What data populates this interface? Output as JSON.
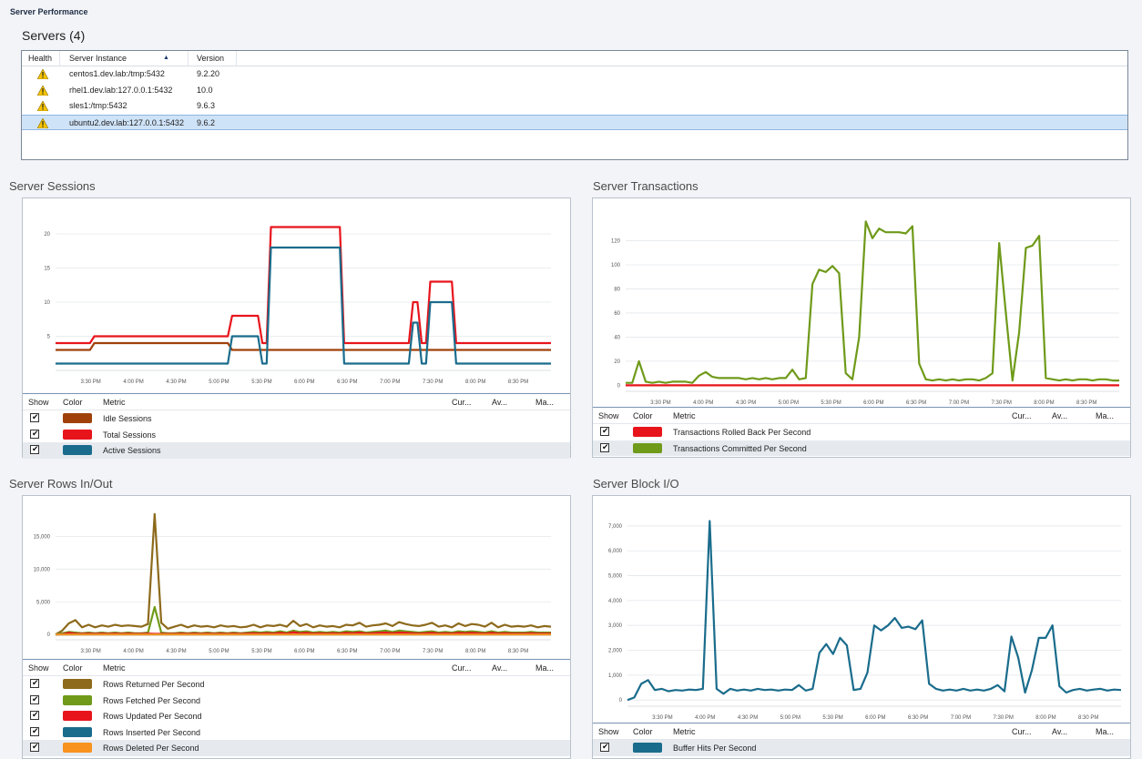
{
  "page": {
    "title": "Server Performance"
  },
  "servers": {
    "title": "Servers (4)",
    "columns": {
      "health": "Health",
      "instance": "Server Instance",
      "sort_indicator": "▲",
      "version": "Version"
    },
    "rows": [
      {
        "instance": "centos1.dev.lab:/tmp:5432",
        "version": "9.2.20",
        "health": "warning-icon"
      },
      {
        "instance": "rhel1.dev.lab:127.0.0.1:5432",
        "version": "10.0",
        "health": "warning-icon"
      },
      {
        "instance": "sles1:/tmp:5432",
        "version": "9.6.3",
        "health": "warning-icon"
      },
      {
        "instance": "ubuntu2.dev.lab:127.0.0.1:5432",
        "version": "9.6.2",
        "health": "warning-icon",
        "selected": true
      }
    ]
  },
  "legend_columns": {
    "show": "Show",
    "color": "Color",
    "metric": "Metric",
    "current": "Cur...",
    "average": "Av...",
    "max": "Ma..."
  },
  "x_tick_labels": [
    "3:30 PM",
    "4:00 PM",
    "4:30 PM",
    "5:00 PM",
    "5:30 PM",
    "6:00 PM",
    "6:30 PM",
    "7:00 PM",
    "7:30 PM",
    "8:00 PM",
    "8:30 PM"
  ],
  "chart_data": [
    {
      "id": "sessions",
      "type": "line",
      "title": "Server Sessions",
      "ylim": [
        0,
        22
      ],
      "yticks": [
        5,
        10,
        15,
        20
      ],
      "ytick_labels": [
        "5",
        "10",
        "15",
        "20"
      ],
      "series": [
        {
          "name": "Idle Sessions",
          "color": "#a0410a",
          "values": [
            3,
            3,
            3,
            3,
            3,
            3,
            3,
            3,
            3,
            4,
            4,
            4,
            4,
            4,
            4,
            4,
            4,
            4,
            4,
            4,
            4,
            4,
            4,
            4,
            4,
            4,
            4,
            4,
            4,
            4,
            4,
            4,
            4,
            4,
            4,
            4,
            4,
            4,
            4,
            4,
            4,
            3,
            3,
            3,
            3,
            3,
            3,
            3,
            3,
            3,
            3,
            3,
            3,
            3,
            3,
            3,
            3,
            3,
            3,
            3,
            3,
            3,
            3,
            3,
            3,
            3,
            3,
            3,
            3,
            3,
            3,
            3,
            3,
            3,
            3,
            3,
            3,
            3,
            3,
            3,
            3,
            3,
            3,
            3,
            3,
            3,
            3,
            3,
            3,
            3,
            3,
            3,
            3,
            3,
            3,
            3,
            3,
            3,
            3,
            3,
            3,
            3,
            3,
            3,
            3,
            3,
            3,
            3,
            3,
            3,
            3,
            3,
            3,
            3,
            3,
            3
          ]
        },
        {
          "name": "Total Sessions",
          "color": "#e8141c",
          "values": [
            4,
            4,
            4,
            4,
            4,
            4,
            4,
            4,
            4,
            5,
            5,
            5,
            5,
            5,
            5,
            5,
            5,
            5,
            5,
            5,
            5,
            5,
            5,
            5,
            5,
            5,
            5,
            5,
            5,
            5,
            5,
            5,
            5,
            5,
            5,
            5,
            5,
            5,
            5,
            5,
            5,
            8,
            8,
            8,
            8,
            8,
            8,
            8,
            4,
            4,
            21,
            21,
            21,
            21,
            21,
            21,
            21,
            21,
            21,
            21,
            21,
            21,
            21,
            21,
            21,
            21,
            21,
            4,
            4,
            4,
            4,
            4,
            4,
            4,
            4,
            4,
            4,
            4,
            4,
            4,
            4,
            4,
            4,
            10,
            10,
            4,
            4,
            13,
            13,
            13,
            13,
            13,
            13,
            4,
            4,
            4,
            4,
            4,
            4,
            4,
            4,
            4,
            4,
            4,
            4,
            4,
            4,
            4,
            4,
            4,
            4,
            4,
            4,
            4,
            4,
            4
          ]
        },
        {
          "name": "Active Sessions",
          "color": "#1a6c8c",
          "values": [
            1,
            1,
            1,
            1,
            1,
            1,
            1,
            1,
            1,
            1,
            1,
            1,
            1,
            1,
            1,
            1,
            1,
            1,
            1,
            1,
            1,
            1,
            1,
            1,
            1,
            1,
            1,
            1,
            1,
            1,
            1,
            1,
            1,
            1,
            1,
            1,
            1,
            1,
            1,
            1,
            1,
            5,
            5,
            5,
            5,
            5,
            5,
            5,
            1,
            1,
            18,
            18,
            18,
            18,
            18,
            18,
            18,
            18,
            18,
            18,
            18,
            18,
            18,
            18,
            18,
            18,
            18,
            1,
            1,
            1,
            1,
            1,
            1,
            1,
            1,
            1,
            1,
            1,
            1,
            1,
            1,
            1,
            1,
            7,
            7,
            1,
            1,
            10,
            10,
            10,
            10,
            10,
            10,
            1,
            1,
            1,
            1,
            1,
            1,
            1,
            1,
            1,
            1,
            1,
            1,
            1,
            1,
            1,
            1,
            1,
            1,
            1,
            1,
            1,
            1,
            1
          ]
        }
      ]
    },
    {
      "id": "transactions",
      "type": "line",
      "title": "Server Transactions",
      "ylim": [
        -5,
        140
      ],
      "yticks": [
        0,
        20,
        40,
        60,
        80,
        100,
        120
      ],
      "ytick_labels": [
        "0",
        "20",
        "40",
        "60",
        "80",
        "100",
        "120"
      ],
      "series": [
        {
          "name": "Transactions Rolled Back Per Second",
          "color": "#e8141c",
          "values": [
            0,
            0,
            0,
            0,
            0,
            0,
            0,
            0,
            0,
            0,
            0,
            0,
            0,
            0,
            0,
            0,
            0,
            0,
            0,
            0,
            0,
            0,
            0,
            0,
            0,
            0,
            0,
            0,
            0,
            0,
            0,
            0,
            0,
            0,
            0,
            0,
            0,
            0,
            0,
            0,
            0,
            0,
            0,
            0,
            0,
            0,
            0,
            0,
            0,
            0,
            0,
            0,
            0,
            0,
            0,
            0,
            0,
            0,
            0,
            0,
            0,
            0,
            0,
            0,
            0,
            0
          ]
        },
        {
          "name": "Transactions Committed Per Second",
          "color": "#6f9a1a",
          "values": [
            2,
            2,
            20,
            3,
            2,
            3,
            2,
            3,
            3,
            3,
            2,
            8,
            11,
            7,
            6,
            6,
            6,
            6,
            5,
            6,
            5,
            6,
            5,
            6,
            6,
            13,
            5,
            6,
            84,
            96,
            94,
            99,
            93,
            10,
            5,
            40,
            136,
            122,
            130,
            127,
            127,
            127,
            126,
            132,
            18,
            5,
            4,
            5,
            4,
            5,
            4,
            5,
            5,
            4,
            6,
            10,
            118,
            60,
            4,
            44,
            114,
            116,
            124,
            6,
            5,
            4,
            5,
            4,
            5,
            5,
            4,
            5,
            5,
            4,
            4
          ]
        }
      ]
    },
    {
      "id": "rows",
      "type": "line",
      "title": "Server Rows In/Out",
      "ylim": [
        -800,
        19500
      ],
      "yticks": [
        0,
        5000,
        10000,
        15000
      ],
      "ytick_labels": [
        "0",
        "5,000",
        "10,000",
        "15,000"
      ],
      "series": [
        {
          "name": "Rows Returned Per Second",
          "color": "#8d6a1c",
          "values": [
            0,
            600,
            1700,
            2200,
            1100,
            1500,
            1100,
            1400,
            1200,
            1500,
            1300,
            1400,
            1300,
            1200,
            1600,
            18400,
            1800,
            900,
            1200,
            1500,
            1100,
            1400,
            1200,
            1300,
            1100,
            1400,
            1200,
            1300,
            1100,
            1200,
            1500,
            1100,
            1400,
            1300,
            1500,
            1200,
            2100,
            1300,
            1600,
            1100,
            1400,
            1200,
            1300,
            1100,
            1500,
            1400,
            1800,
            1200,
            1400,
            1500,
            1700,
            1300,
            1900,
            1600,
            1400,
            1300,
            1500,
            1800,
            1200,
            1400,
            1100,
            1700,
            1300,
            1600,
            1500,
            1200,
            1800,
            1100,
            1500,
            1200,
            1300,
            1200,
            1400,
            1100,
            1300,
            1200
          ]
        },
        {
          "name": "Rows Fetched Per Second",
          "color": "#6f9a1a",
          "values": [
            0,
            200,
            400,
            300,
            200,
            300,
            200,
            300,
            200,
            300,
            200,
            300,
            200,
            200,
            300,
            4200,
            300,
            200,
            200,
            300,
            200,
            300,
            200,
            300,
            200,
            300,
            200,
            300,
            200,
            300,
            400,
            300,
            400,
            300,
            500,
            300,
            600,
            400,
            500,
            300,
            400,
            300,
            400,
            300,
            500,
            400,
            500,
            300,
            400,
            500,
            600,
            400,
            600,
            500,
            400,
            300,
            400,
            500,
            300,
            400,
            300,
            500,
            400,
            500,
            400,
            300,
            500,
            300,
            400,
            300,
            300,
            300,
            400,
            300,
            300,
            300
          ]
        },
        {
          "name": "Rows Updated Per Second",
          "color": "#e8141c",
          "values": [
            0,
            50,
            250,
            150,
            100,
            150,
            100,
            150,
            100,
            150,
            100,
            150,
            100,
            100,
            150,
            100,
            100,
            100,
            100,
            150,
            100,
            150,
            100,
            150,
            100,
            150,
            100,
            150,
            100,
            150,
            200,
            150,
            200,
            150,
            250,
            150,
            350,
            200,
            250,
            150,
            200,
            150,
            200,
            150,
            250,
            200,
            300,
            150,
            200,
            250,
            300,
            200,
            300,
            250,
            200,
            150,
            200,
            250,
            150,
            200,
            150,
            250,
            200,
            250,
            200,
            150,
            250,
            150,
            200,
            150,
            150,
            150,
            200,
            150,
            150,
            150
          ]
        },
        {
          "name": "Rows Inserted Per Second",
          "color": "#1a6c8c",
          "values": [
            0,
            0,
            0,
            0,
            0,
            0,
            0,
            0,
            0,
            0,
            0,
            0,
            0,
            0,
            0,
            0,
            0,
            0,
            0,
            0,
            0,
            0,
            0,
            0,
            0,
            0,
            0,
            0,
            0,
            0,
            0,
            0,
            0,
            0,
            0,
            0,
            0,
            0,
            0,
            0,
            0,
            0,
            0,
            0,
            0,
            0,
            0,
            0,
            0,
            0,
            0,
            0,
            0,
            0,
            0,
            0,
            0,
            0,
            0,
            0,
            0,
            0,
            0,
            0,
            0,
            0,
            0,
            0,
            0,
            0,
            0,
            0,
            0,
            0,
            0,
            0
          ]
        },
        {
          "name": "Rows Deleted Per Second",
          "color": "#f7931e",
          "values": [
            0,
            0,
            0,
            0,
            0,
            0,
            0,
            0,
            0,
            0,
            0,
            0,
            0,
            0,
            0,
            0,
            0,
            0,
            0,
            0,
            0,
            0,
            0,
            0,
            0,
            0,
            0,
            0,
            0,
            0,
            0,
            0,
            0,
            0,
            0,
            0,
            0,
            0,
            0,
            0,
            0,
            0,
            0,
            0,
            0,
            0,
            0,
            0,
            0,
            0,
            0,
            0,
            0,
            0,
            0,
            0,
            0,
            0,
            0,
            0,
            0,
            0,
            0,
            0,
            0,
            0,
            0,
            0,
            0,
            0,
            0,
            0,
            0,
            0,
            0,
            0
          ]
        }
      ]
    },
    {
      "id": "blockio",
      "type": "line",
      "title": "Server Block I/O",
      "ylim": [
        -250,
        7400
      ],
      "yticks": [
        0,
        1000,
        2000,
        3000,
        4000,
        5000,
        6000,
        7000
      ],
      "ytick_labels": [
        "0",
        "1,000",
        "2,000",
        "3,000",
        "4,000",
        "5,000",
        "6,000",
        "7,000"
      ],
      "series": [
        {
          "name": "Buffer Hits Per Second",
          "color": "#1a6c8c",
          "values": [
            0,
            100,
            650,
            800,
            400,
            450,
            350,
            400,
            380,
            420,
            400,
            450,
            7200,
            450,
            250,
            450,
            380,
            420,
            380,
            450,
            400,
            420,
            380,
            420,
            400,
            600,
            380,
            450,
            1900,
            2250,
            1850,
            2500,
            2200,
            400,
            450,
            1100,
            3000,
            2800,
            3000,
            3300,
            2900,
            2950,
            2850,
            3200,
            650,
            450,
            380,
            420,
            380,
            450,
            380,
            420,
            380,
            450,
            600,
            350,
            2550,
            1700,
            300,
            1200,
            2500,
            2500,
            3000,
            550,
            300,
            400,
            450,
            380,
            420,
            450,
            380,
            420,
            400
          ]
        }
      ]
    }
  ]
}
